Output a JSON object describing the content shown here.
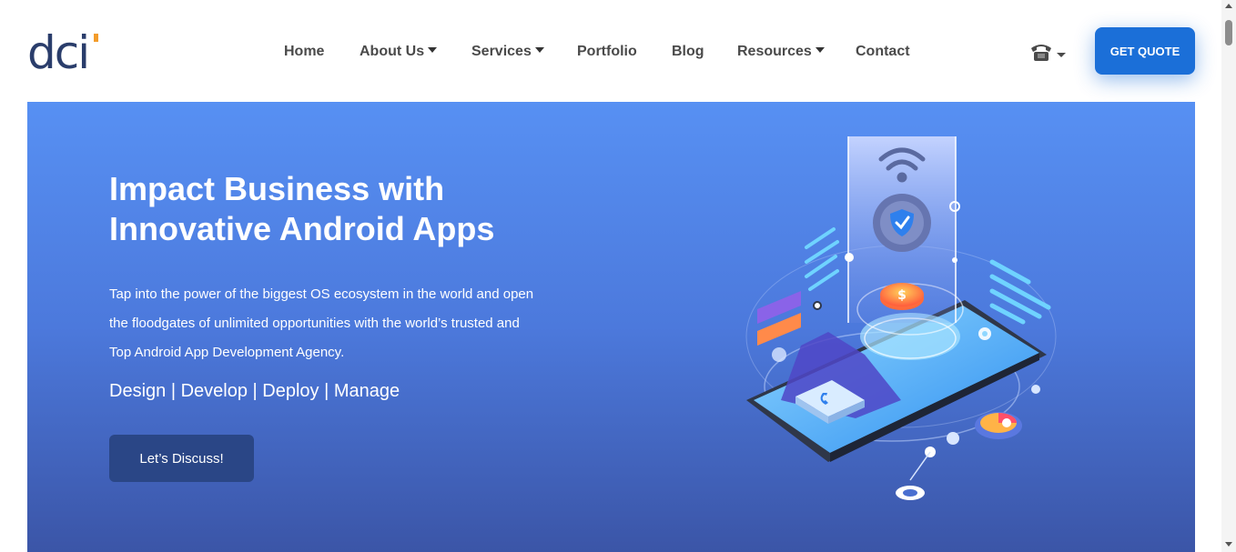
{
  "brand": {
    "logo_text": "dci",
    "accent_color": "#f39c2b",
    "primary_color": "#2a3d6b"
  },
  "nav": {
    "items": [
      {
        "label": "Home",
        "dropdown": false
      },
      {
        "label": "About Us",
        "dropdown": true
      },
      {
        "label": "Services",
        "dropdown": true
      },
      {
        "label": "Portfolio",
        "dropdown": false
      },
      {
        "label": "Blog",
        "dropdown": false
      },
      {
        "label": "Resources",
        "dropdown": true
      },
      {
        "label": "Contact",
        "dropdown": false
      }
    ]
  },
  "header": {
    "phone_icon": "phone-icon",
    "cta_label": "GET QUOTE",
    "cta_color": "#1b6fd8"
  },
  "hero": {
    "title_line1": "Impact Business with",
    "title_line2": "Innovative Android Apps",
    "description_lines": [
      "Tap into the power of the biggest OS ecosystem in the world and open",
      "the floodgates of unlimited opportunities with the world’s trusted and",
      "Top Android App Development Agency."
    ],
    "tagline": "Design | Develop | Deploy | Manage",
    "button_label": "Let’s Discuss!",
    "gradient": [
      "#5790f3",
      "#3b55a7"
    ],
    "illustration": "isometric-smartphone-illustration"
  }
}
